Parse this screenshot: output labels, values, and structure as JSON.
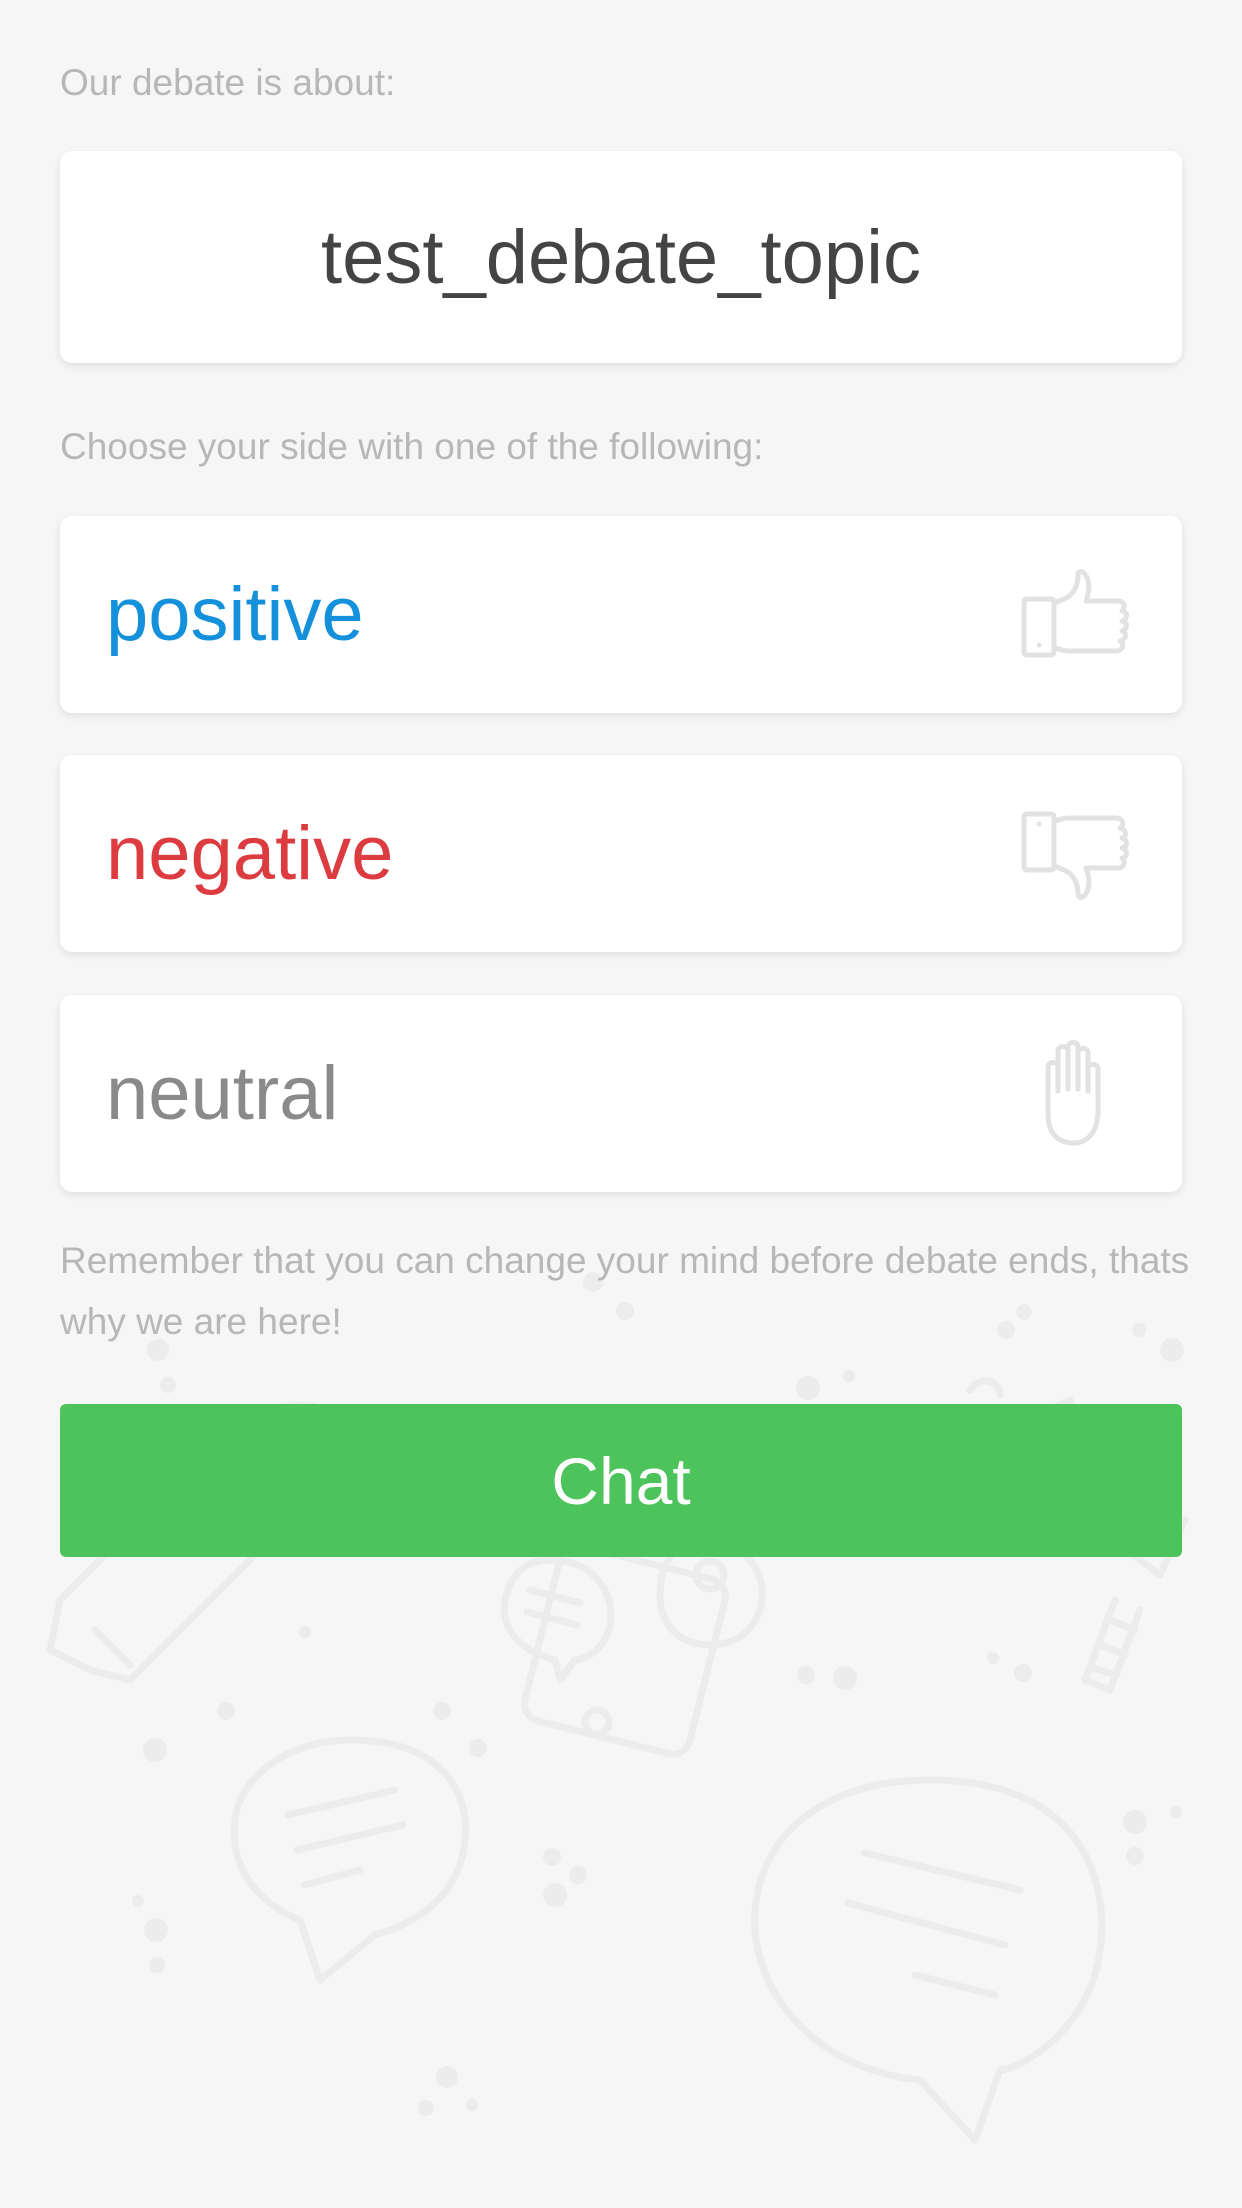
{
  "topic_prompt": "Our debate is about:",
  "topic": "test_debate_topic",
  "side_prompt": "Choose your side with one of the following:",
  "options": [
    {
      "label": "positive",
      "color": "#1591db",
      "icon": "thumbs-up-icon"
    },
    {
      "label": "negative",
      "color": "#dc3b40",
      "icon": "thumbs-down-icon"
    },
    {
      "label": "neutral",
      "color": "#8a8a8a",
      "icon": "raised-hand-icon"
    }
  ],
  "reminder": "Remember that you can change your mind before debate ends, thats why we are here!",
  "chat_button_label": "Chat",
  "colors": {
    "background": "#f5f6f5",
    "muted_text": "#b7b7b7",
    "chat_button": "#4dc45b",
    "icon_stroke": "#e2e2e2"
  }
}
